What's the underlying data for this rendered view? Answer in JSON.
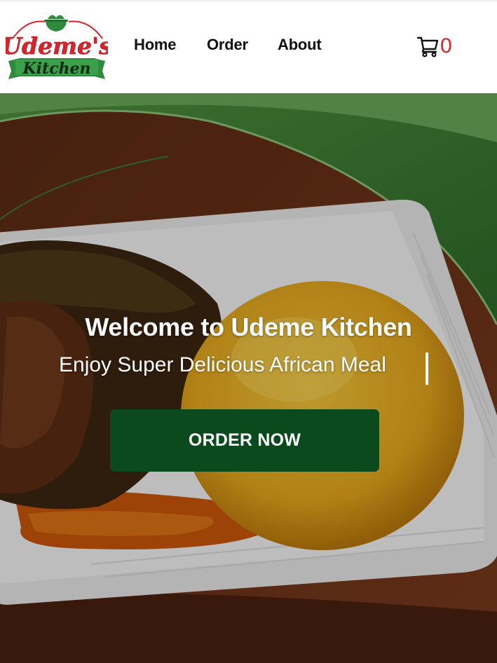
{
  "brand": {
    "logo_line1": "Udeme's",
    "logo_line2": "Kitchen",
    "colors": {
      "red": "#d9232a",
      "green": "#2e8b3d",
      "dark_green": "#0a4a1c"
    }
  },
  "nav": {
    "home": "Home",
    "order": "Order",
    "about": "About"
  },
  "cart": {
    "icon": "cart-icon",
    "count": "0"
  },
  "hero": {
    "title": "Welcome to Udeme Kitchen",
    "subtitle": "Enjoy Super Delicious African Meal",
    "cta": "ORDER NOW"
  }
}
